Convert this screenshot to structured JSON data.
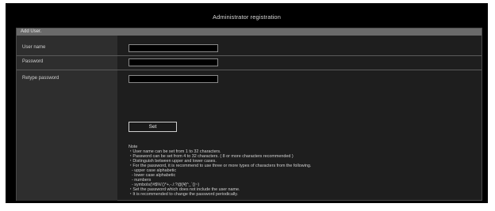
{
  "page": {
    "title": "Administrator registration"
  },
  "panel": {
    "header": "Add User."
  },
  "form": {
    "user_name": {
      "label": "User name",
      "value": ""
    },
    "password": {
      "label": "Password",
      "value": ""
    },
    "retype_password": {
      "label": "Retype password",
      "value": ""
    }
  },
  "set_button": {
    "label": "Set"
  },
  "note": {
    "heading": "Note",
    "lines": [
      "・User name can be set from 1 to 32 characters.",
      "・Password can be set from 4 to 32 characters. ( 8 or more characters recommended )",
      "・Distinguish between upper and lower cases.",
      "・For the password, it is recommend to use three or more types of characters from the following.",
      "- upper case alphabetic",
      "- lower case alphabetic",
      "- numbers",
      "- symbols(!#$%'()*+,-./:?@[¥]^_`{}~)",
      "・Set the password which does not include the user name.",
      "・It is recommended to change the password periodically."
    ]
  },
  "colors": {
    "background": "#000000",
    "panel_header": "#6a6a6a",
    "label_column": "#2e2e2e",
    "text": "#d0d0d0"
  }
}
